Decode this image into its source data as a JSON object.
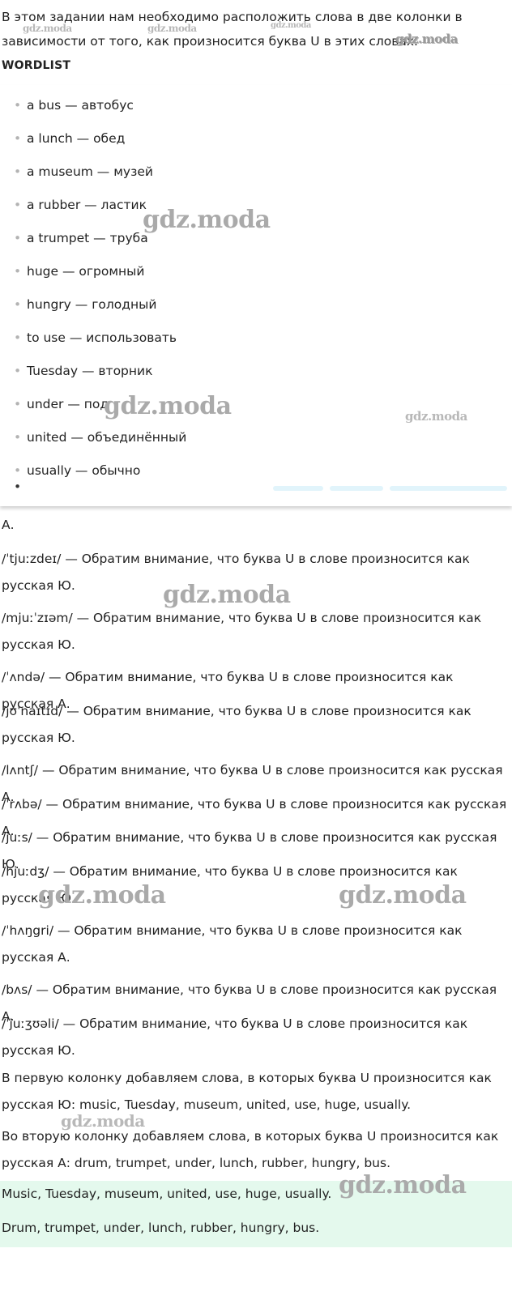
{
  "intro": "В этом задании нам необходимо расположить слова в две колонки в зависимости от того, как произносится буква U в этих словах.",
  "wordlist_title": "WORDLIST",
  "wordlist": [
    "a bus — автобус",
    "a lunch — обед",
    "a museum — музей",
    "a rubber — ластик",
    "a trumpet — труба",
    "huge — огромный",
    "hungry — голодный",
    "to use — использовать",
    "Tuesday — вторник",
    "under — под",
    "united — объединённый",
    "usually — обычно"
  ],
  "bullet_glyph": "•",
  "partial_line": "А.",
  "paragraphs": [
    "/ˈtjuːzdeɪ/ — Обратим внимание, что буква U в слове произносится как русская Ю.",
    "/mjuːˈzɪəm/ — Обратим внимание, что буква U в слове произносится как русская Ю.",
    "/ˈʌndə/ — Обратим внимание, что буква U в слове произносится как русская А.",
    "/jʊˈnaɪtɪd/ — Обратим внимание, что буква U в слове произносится как русская Ю.",
    "/lʌntʃ/ — Обратим внимание, что буква U в слове произносится как русская А.",
    "/ˈrʌbə/ — Обратим внимание, что буква U в слове произносится как русская А.",
    "/juːs/ — Обратим внимание, что буква U в слове произносится как русская Ю.",
    "/hjuːdʒ/ — Обратим внимание, что буква U в слове произносится как русская Ю.",
    "/ˈhʌŋgri/ — Обратим внимание, что буква U в слове произносится как русская А.",
    "/bʌs/ — Обратим внимание, что буква U в слове произносится как русская А.",
    "/ˈjuːʒʊəli/ — Обратим внимание, что буква U в слове произносится как русская Ю.",
    "В первую колонку добавляем слова, в которых буква U произносится как русская Ю: music, Tuesday, museum, united, use, huge, usually.",
    "Во вторую колонку добавляем слова, в которых буква U произносится как русская А: drum, trumpet, under, lunch, rubber, hungry, bus."
  ],
  "answer": [
    "Music, Tuesday, museum, united, use, huge, usually.",
    "Drum, trumpet, under, lunch, rubber, hungry, bus."
  ],
  "watermark": "gdz.moda",
  "colors": {
    "answer_bg": "#e4f9ed",
    "bar": "#e1f4fb",
    "bullet": "#b3b3b3"
  }
}
